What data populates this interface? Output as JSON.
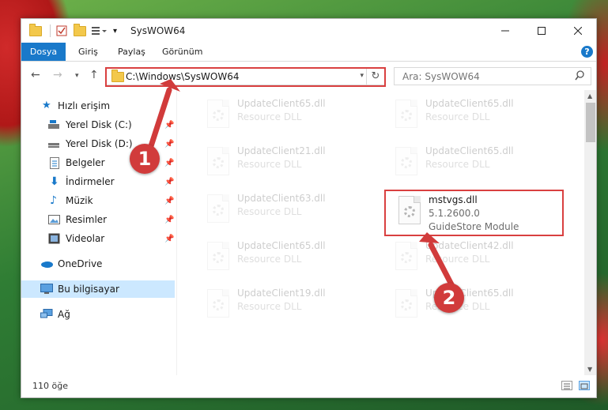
{
  "window": {
    "title": "SysWOW64"
  },
  "ribbon": {
    "tabs": [
      "Dosya",
      "Giriş",
      "Paylaş",
      "Görünüm"
    ],
    "help": "?"
  },
  "nav": {
    "address": "C:\\Windows\\SysWOW64",
    "search_placeholder": "Ara: SysWOW64"
  },
  "sidebar": {
    "items": [
      {
        "label": "Hızlı erişim",
        "icon": "star-icon"
      },
      {
        "label": "Yerel Disk (C:)",
        "icon": "drive-icon",
        "pinned": true
      },
      {
        "label": "Yerel Disk (D:)",
        "icon": "drive-icon",
        "pinned": true
      },
      {
        "label": "Belgeler",
        "icon": "document-icon",
        "pinned": true
      },
      {
        "label": "İndirmeler",
        "icon": "download-icon",
        "pinned": true
      },
      {
        "label": "Müzik",
        "icon": "music-icon",
        "pinned": true
      },
      {
        "label": "Resimler",
        "icon": "pictures-icon",
        "pinned": true
      },
      {
        "label": "Videolar",
        "icon": "video-icon",
        "pinned": true
      },
      {
        "label": "OneDrive",
        "icon": "cloud-icon"
      },
      {
        "label": "Bu bilgisayar",
        "icon": "computer-icon",
        "selected": true
      },
      {
        "label": "Ağ",
        "icon": "network-icon"
      }
    ]
  },
  "files": [
    {
      "name": "UpdateClient65.dll",
      "desc": "Resource DLL"
    },
    {
      "name": "UpdateClient65.dll",
      "desc": "Resource DLL"
    },
    {
      "name": "UpdateClient21.dll",
      "desc": "Resource DLL"
    },
    {
      "name": "UpdateClient65.dll",
      "desc": "Resource DLL"
    },
    {
      "name": "UpdateClient63.dll",
      "desc": "Resource DLL"
    },
    {
      "name": "mstvgs.dll",
      "version": "5.1.2600.0",
      "desc": "GuideStore Module",
      "highlighted": true
    },
    {
      "name": "UpdateClient65.dll",
      "desc": "Resource DLL"
    },
    {
      "name": "UpdateClient42.dll",
      "desc": "Resource DLL"
    },
    {
      "name": "UpdateClient19.dll",
      "desc": "Resource DLL"
    },
    {
      "name": "UpdateClient65.dll",
      "desc": "Resource DLL"
    }
  ],
  "status": {
    "count": "110 öğe"
  },
  "annotations": [
    "1",
    "2"
  ],
  "colors": {
    "accent": "#1979ca",
    "annotation": "#d13b3b",
    "selected": "#cce8ff"
  }
}
